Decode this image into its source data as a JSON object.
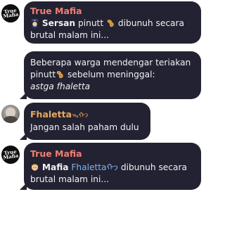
{
  "messages": [
    {
      "sender": "True Mafia",
      "avatar_text": [
        "True",
        "Mafia"
      ],
      "parts": {
        "role": "Sersan",
        "t1": " pinutt",
        "t2": " dibunuh secara",
        "line2": "brutal malam ini..."
      },
      "icons": [
        "police-officer-icon",
        "peanut-icon"
      ]
    },
    {
      "sender": "",
      "line1": "Beberapa warga mendengar teriakan",
      "line2a": "pinutt",
      "line2b": " sebelum meninggal:",
      "line3": "astga fhaletta",
      "icons": [
        "peanut-icon"
      ]
    },
    {
      "sender": "Fhaletta",
      "sender_suffix": "ᯓ⁠ᡣ𐭩",
      "text": "Jangan salah paham dulu"
    },
    {
      "sender": "True Mafia",
      "avatar_text": [
        "True",
        "Mafia"
      ],
      "parts": {
        "role": "Mafia",
        "name": "Fhalettaᡣ𐭩",
        "t2": " dibunuh secara",
        "line2": "brutal malam ini..."
      },
      "icons": [
        "blond-person-icon"
      ]
    }
  ],
  "colors": {
    "bubble": "#232232",
    "mafia_name": "#f07f72",
    "fhaletta_name": "#e8a85e",
    "link": "#7fb3ee"
  }
}
